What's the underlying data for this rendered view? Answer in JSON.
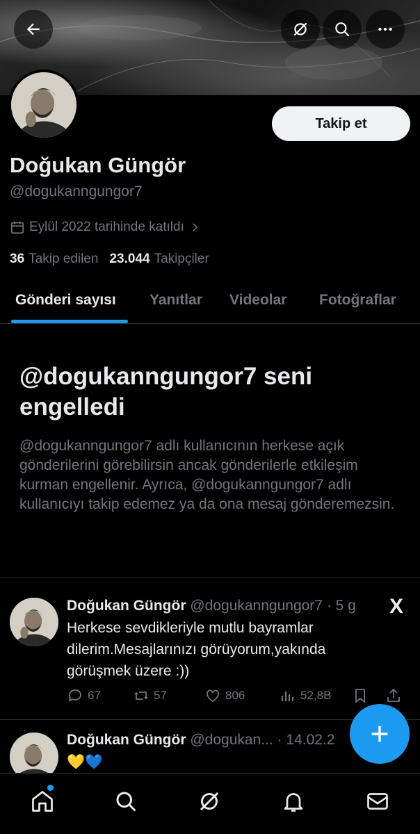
{
  "header": {
    "back_icon": "arrow-left-icon",
    "grok_icon": "grok-icon",
    "search_icon": "search-icon",
    "more_icon": "more-horizontal-icon"
  },
  "profile": {
    "follow_label": "Takip et",
    "name": "Doğukan Güngör",
    "handle": "@dogukanngungor7",
    "joined": "Eylül 2022 tarihinde katıldı",
    "following_count": "36",
    "following_label": "Takip edilen",
    "followers_count": "23.044",
    "followers_label": "Takipçiler"
  },
  "tabs": [
    {
      "label": "Gönderi sayısı",
      "active": true
    },
    {
      "label": "Yanıtlar",
      "active": false
    },
    {
      "label": "Videolar",
      "active": false
    },
    {
      "label": "Fotoğraflar",
      "active": false
    }
  ],
  "block_notice": {
    "title": "@dogukanngungor7 seni engelledi",
    "description": "@dogukanngungor7 adlı kullanıcının herkese açık gönderilerini görebilirsin ancak gönderilerle etkileşim kurman engellenir. Ayrıca, @dogukanngungor7 adlı kullanıcıyı takip edemez ya da ona mesaj gönderemezsin."
  },
  "posts": [
    {
      "name": "Doğukan Güngör",
      "meta": "@dogukanngungor7 · 5 g",
      "text": "Herkese sevdikleriyle mutlu bayramlar dilerim.Mesajlarınızı görüyorum,yakında görüşmek üzere :))",
      "replies": "67",
      "reposts": "57",
      "likes": "806",
      "views": "52,8B",
      "source_logo": "X"
    },
    {
      "name": "Doğukan Güngör",
      "meta": "@dogukan... · 14.02.2",
      "text": "💛💙"
    }
  ],
  "colors": {
    "accent": "#1d9bf0",
    "muted": "#71767b",
    "text": "#e7e9ea",
    "border": "#2f3336"
  },
  "bottom_nav": [
    "home-icon",
    "search-icon",
    "grok-icon",
    "notifications-icon",
    "messages-icon"
  ]
}
